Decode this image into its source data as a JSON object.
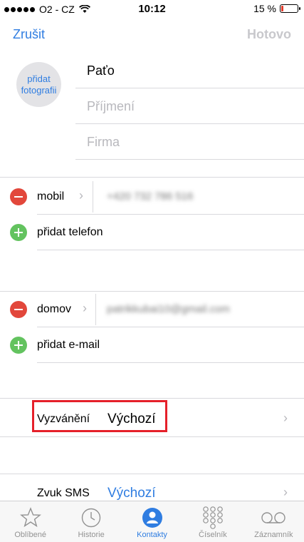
{
  "status_bar": {
    "carrier": "O2 - CZ",
    "time": "10:12",
    "battery": "15 %",
    "battery_level": 0.15
  },
  "nav": {
    "cancel": "Zrušit",
    "done": "Hotovo"
  },
  "photo": {
    "label": "přidat fotografii"
  },
  "fields": {
    "first_name": "Paťo",
    "last_name_placeholder": "Příjmení",
    "company_placeholder": "Firma"
  },
  "phone": {
    "label": "mobil",
    "value": "+420 732 786 516",
    "add_label": "přidat telefon"
  },
  "email": {
    "label": "domov",
    "value": "patrikkubai10@gmail.com",
    "add_label": "přidat e-mail"
  },
  "ringtone": {
    "label": "Vyzvánění",
    "value": "Výchozí"
  },
  "sms_tone": {
    "label": "Zvuk SMS",
    "value": "Výchozí"
  },
  "colors": {
    "accent": "#2f7de1",
    "remove": "#e2473b",
    "add": "#63c35f",
    "highlight": "#e5202a"
  },
  "tabs": [
    {
      "label": "Oblíbené",
      "icon": "star-icon"
    },
    {
      "label": "Historie",
      "icon": "clock-icon"
    },
    {
      "label": "Kontakty",
      "icon": "person-icon"
    },
    {
      "label": "Číselník",
      "icon": "keypad-icon"
    },
    {
      "label": "Záznamník",
      "icon": "voicemail-icon"
    }
  ]
}
